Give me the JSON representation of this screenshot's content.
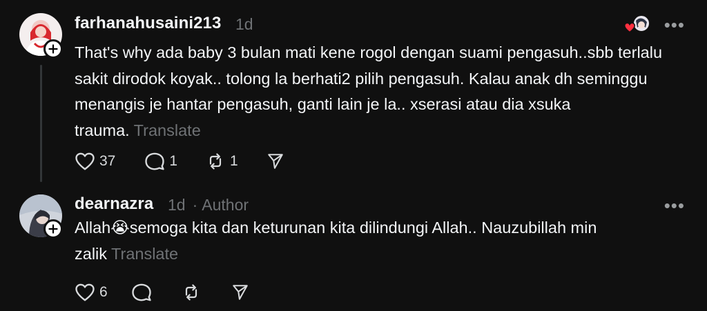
{
  "posts": [
    {
      "username": "farhanahusaini213",
      "time": "1d",
      "author_tag": "",
      "text": "That's why ada baby 3 bulan mati kene rogol dengan suami pengasuh..sbb terlalu sakit dirodok koyak.. tolong la berhati2 pilih pengasuh. Kalau anak dh seminggu menangis je hantar pengasuh, ganti lain je la.. xserasi atau dia xsuka trauma.",
      "translate_label": "Translate",
      "likes": "37",
      "replies": "1",
      "reposts": "1",
      "liked_by_author": true
    },
    {
      "username": "dearnazra",
      "time": "1d",
      "separator": "·",
      "author_tag": "Author",
      "text": "Allah😭semoga kita dan keturunan kita dilindungi Allah.. Nauzubillah min zalik",
      "translate_label": "Translate",
      "likes": "6",
      "replies": "",
      "reposts": ""
    }
  ],
  "more_label": "•••",
  "icons": {
    "like": "heart-icon",
    "reply": "comment-icon",
    "repost": "repost-icon",
    "share": "send-icon",
    "follow": "plus-icon",
    "more": "more-icon"
  },
  "colors": {
    "background": "#101010",
    "text": "#f3f5f7",
    "secondary": "#6f7275",
    "like_red": "#ff3040"
  }
}
